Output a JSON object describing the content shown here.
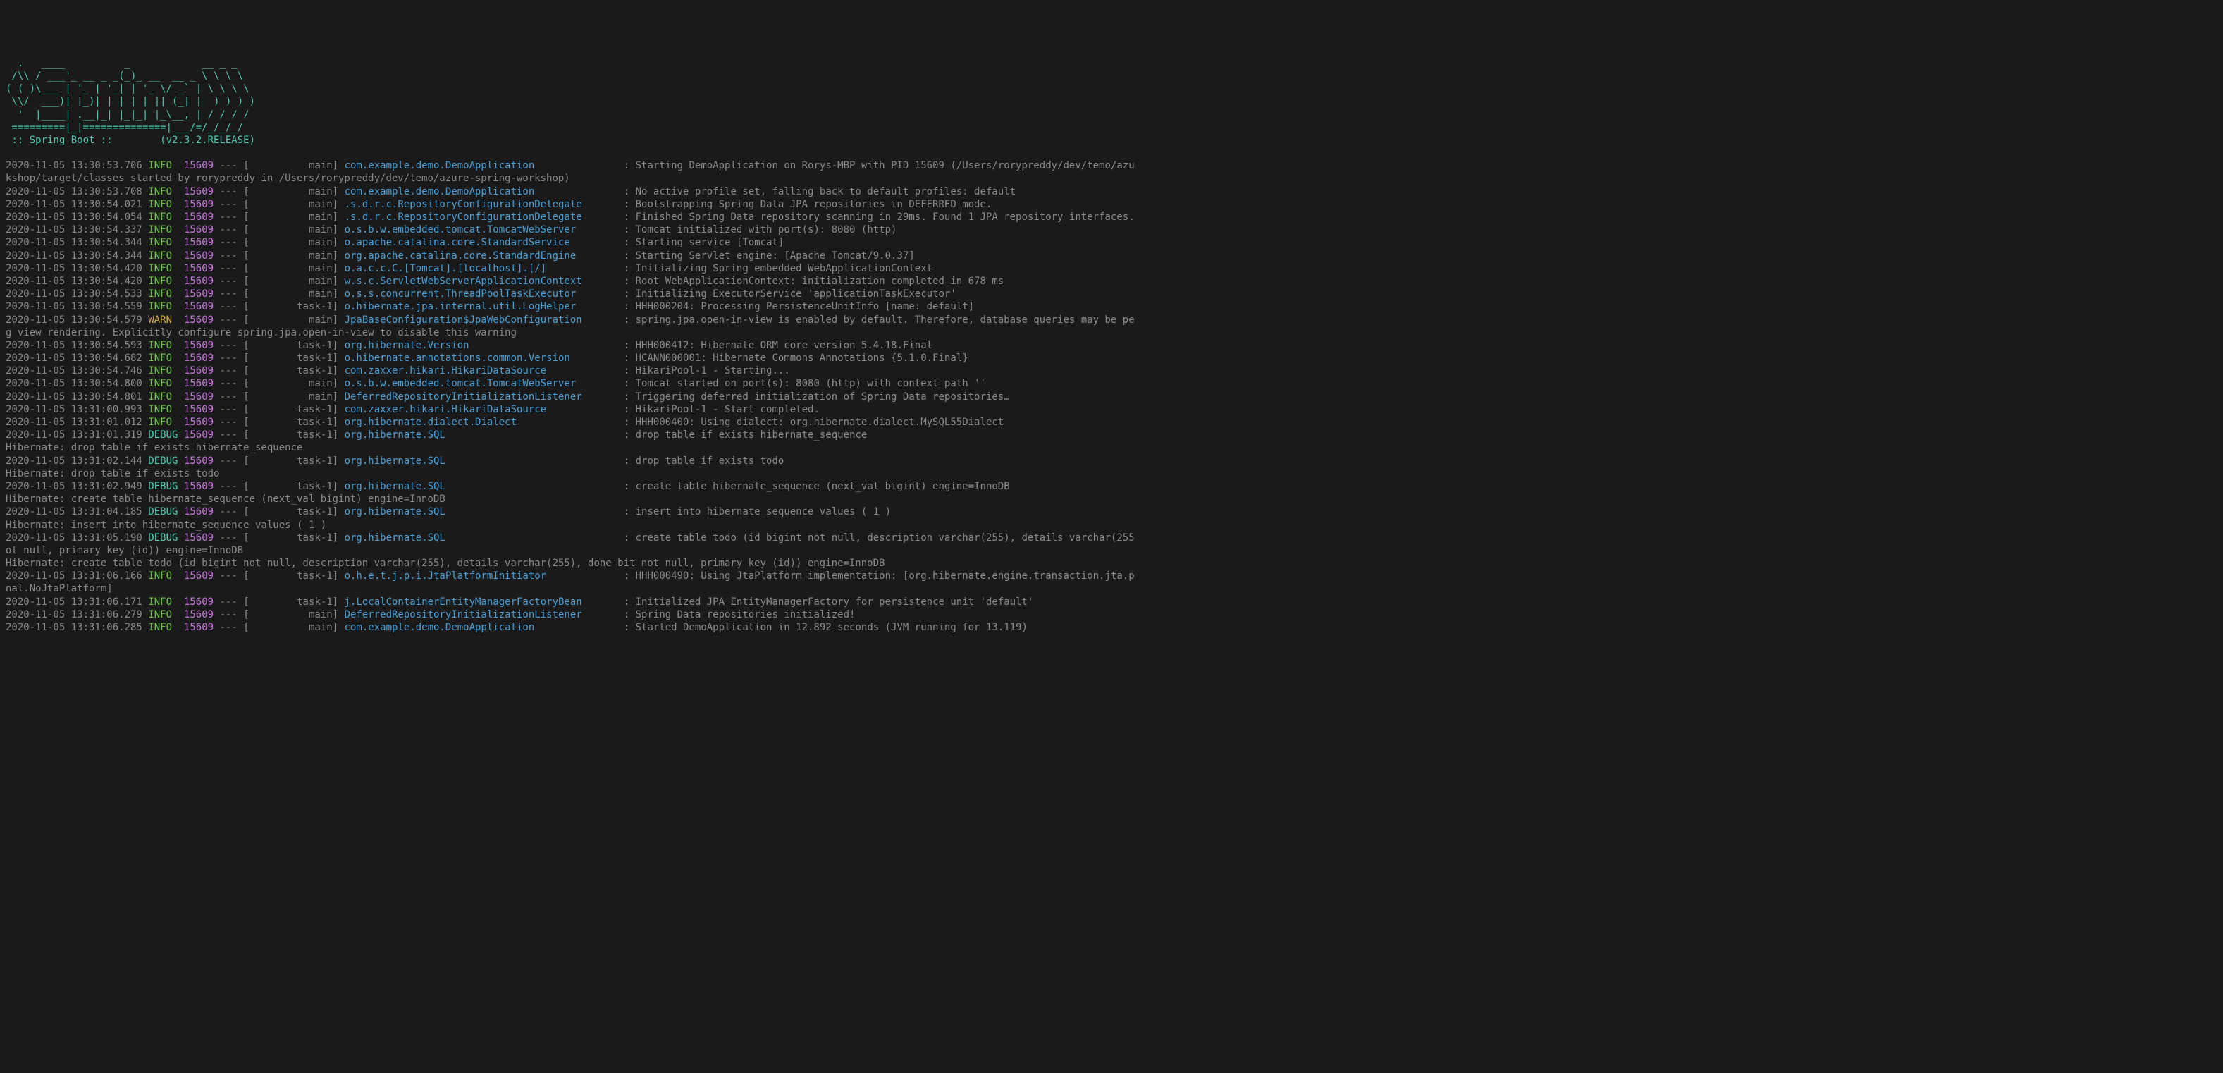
{
  "banner": {
    "ascii_line1": "  .   ____          _            __ _ _",
    "ascii_line2": " /\\\\ / ___'_ __ _ _(_)_ __  __ _ \\ \\ \\ \\",
    "ascii_line3": "( ( )\\___ | '_ | '_| | '_ \\/ _` | \\ \\ \\ \\",
    "ascii_line4": " \\\\/  ___)| |_)| | | | | || (_| |  ) ) ) )",
    "ascii_line5": "  '  |____| .__|_| |_|_| |_\\__, | / / / /",
    "ascii_line6": " =========|_|==============|___/=/_/_/_/",
    "boot_line": " :: Spring Boot ::        (v2.3.2.RELEASE)"
  },
  "logs": [
    {
      "ts": "2020-11-05 13:30:53.706",
      "level": "INFO",
      "pid": "15609",
      "thread": "          main",
      "logger": "com.example.demo.DemoApplication              ",
      "msg": "Starting DemoApplication on Rorys-MBP with PID 15609 (/Users/rorypreddy/dev/temo/azu"
    },
    {
      "continuation": "kshop/target/classes started by rorypreddy in /Users/rorypreddy/dev/temo/azure-spring-workshop)"
    },
    {
      "ts": "2020-11-05 13:30:53.708",
      "level": "INFO",
      "pid": "15609",
      "thread": "          main",
      "logger": "com.example.demo.DemoApplication              ",
      "msg": "No active profile set, falling back to default profiles: default"
    },
    {
      "ts": "2020-11-05 13:30:54.021",
      "level": "INFO",
      "pid": "15609",
      "thread": "          main",
      "logger": ".s.d.r.c.RepositoryConfigurationDelegate      ",
      "msg": "Bootstrapping Spring Data JPA repositories in DEFERRED mode."
    },
    {
      "ts": "2020-11-05 13:30:54.054",
      "level": "INFO",
      "pid": "15609",
      "thread": "          main",
      "logger": ".s.d.r.c.RepositoryConfigurationDelegate      ",
      "msg": "Finished Spring Data repository scanning in 29ms. Found 1 JPA repository interfaces."
    },
    {
      "ts": "2020-11-05 13:30:54.337",
      "level": "INFO",
      "pid": "15609",
      "thread": "          main",
      "logger": "o.s.b.w.embedded.tomcat.TomcatWebServer       ",
      "msg": "Tomcat initialized with port(s): 8080 (http)"
    },
    {
      "ts": "2020-11-05 13:30:54.344",
      "level": "INFO",
      "pid": "15609",
      "thread": "          main",
      "logger": "o.apache.catalina.core.StandardService        ",
      "msg": "Starting service [Tomcat]"
    },
    {
      "ts": "2020-11-05 13:30:54.344",
      "level": "INFO",
      "pid": "15609",
      "thread": "          main",
      "logger": "org.apache.catalina.core.StandardEngine       ",
      "msg": "Starting Servlet engine: [Apache Tomcat/9.0.37]"
    },
    {
      "ts": "2020-11-05 13:30:54.420",
      "level": "INFO",
      "pid": "15609",
      "thread": "          main",
      "logger": "o.a.c.c.C.[Tomcat].[localhost].[/]            ",
      "msg": "Initializing Spring embedded WebApplicationContext"
    },
    {
      "ts": "2020-11-05 13:30:54.420",
      "level": "INFO",
      "pid": "15609",
      "thread": "          main",
      "logger": "w.s.c.ServletWebServerApplicationContext      ",
      "msg": "Root WebApplicationContext: initialization completed in 678 ms"
    },
    {
      "ts": "2020-11-05 13:30:54.533",
      "level": "INFO",
      "pid": "15609",
      "thread": "          main",
      "logger": "o.s.s.concurrent.ThreadPoolTaskExecutor       ",
      "msg": "Initializing ExecutorService 'applicationTaskExecutor'"
    },
    {
      "ts": "2020-11-05 13:30:54.559",
      "level": "INFO",
      "pid": "15609",
      "thread": "        task-1",
      "logger": "o.hibernate.jpa.internal.util.LogHelper       ",
      "msg": "HHH000204: Processing PersistenceUnitInfo [name: default]"
    },
    {
      "ts": "2020-11-05 13:30:54.579",
      "level": "WARN",
      "pid": "15609",
      "thread": "          main",
      "logger": "JpaBaseConfiguration$JpaWebConfiguration      ",
      "msg": "spring.jpa.open-in-view is enabled by default. Therefore, database queries may be pe"
    },
    {
      "continuation": "g view rendering. Explicitly configure spring.jpa.open-in-view to disable this warning"
    },
    {
      "ts": "2020-11-05 13:30:54.593",
      "level": "INFO",
      "pid": "15609",
      "thread": "        task-1",
      "logger": "org.hibernate.Version                         ",
      "msg": "HHH000412: Hibernate ORM core version 5.4.18.Final"
    },
    {
      "ts": "2020-11-05 13:30:54.682",
      "level": "INFO",
      "pid": "15609",
      "thread": "        task-1",
      "logger": "o.hibernate.annotations.common.Version        ",
      "msg": "HCANN000001: Hibernate Commons Annotations {5.1.0.Final}"
    },
    {
      "ts": "2020-11-05 13:30:54.746",
      "level": "INFO",
      "pid": "15609",
      "thread": "        task-1",
      "logger": "com.zaxxer.hikari.HikariDataSource            ",
      "msg": "HikariPool-1 - Starting..."
    },
    {
      "ts": "2020-11-05 13:30:54.800",
      "level": "INFO",
      "pid": "15609",
      "thread": "          main",
      "logger": "o.s.b.w.embedded.tomcat.TomcatWebServer       ",
      "msg": "Tomcat started on port(s): 8080 (http) with context path ''"
    },
    {
      "ts": "2020-11-05 13:30:54.801",
      "level": "INFO",
      "pid": "15609",
      "thread": "          main",
      "logger": "DeferredRepositoryInitializationListener      ",
      "msg": "Triggering deferred initialization of Spring Data repositories…"
    },
    {
      "ts": "2020-11-05 13:31:00.993",
      "level": "INFO",
      "pid": "15609",
      "thread": "        task-1",
      "logger": "com.zaxxer.hikari.HikariDataSource            ",
      "msg": "HikariPool-1 - Start completed."
    },
    {
      "ts": "2020-11-05 13:31:01.012",
      "level": "INFO",
      "pid": "15609",
      "thread": "        task-1",
      "logger": "org.hibernate.dialect.Dialect                 ",
      "msg": "HHH000400: Using dialect: org.hibernate.dialect.MySQL55Dialect"
    },
    {
      "ts": "2020-11-05 13:31:01.319",
      "level": "DEBUG",
      "pid": "15609",
      "thread": "        task-1",
      "logger": "org.hibernate.SQL                             ",
      "msg": "drop table if exists hibernate_sequence"
    },
    {
      "continuation": "Hibernate: drop table if exists hibernate_sequence"
    },
    {
      "ts": "2020-11-05 13:31:02.144",
      "level": "DEBUG",
      "pid": "15609",
      "thread": "        task-1",
      "logger": "org.hibernate.SQL                             ",
      "msg": "drop table if exists todo"
    },
    {
      "continuation": "Hibernate: drop table if exists todo"
    },
    {
      "ts": "2020-11-05 13:31:02.949",
      "level": "DEBUG",
      "pid": "15609",
      "thread": "        task-1",
      "logger": "org.hibernate.SQL                             ",
      "msg": "create table hibernate_sequence (next_val bigint) engine=InnoDB"
    },
    {
      "continuation": "Hibernate: create table hibernate_sequence (next_val bigint) engine=InnoDB"
    },
    {
      "ts": "2020-11-05 13:31:04.185",
      "level": "DEBUG",
      "pid": "15609",
      "thread": "        task-1",
      "logger": "org.hibernate.SQL                             ",
      "msg": "insert into hibernate_sequence values ( 1 )"
    },
    {
      "continuation": "Hibernate: insert into hibernate_sequence values ( 1 )"
    },
    {
      "ts": "2020-11-05 13:31:05.190",
      "level": "DEBUG",
      "pid": "15609",
      "thread": "        task-1",
      "logger": "org.hibernate.SQL                             ",
      "msg": "create table todo (id bigint not null, description varchar(255), details varchar(255"
    },
    {
      "continuation": "ot null, primary key (id)) engine=InnoDB"
    },
    {
      "continuation": "Hibernate: create table todo (id bigint not null, description varchar(255), details varchar(255), done bit not null, primary key (id)) engine=InnoDB"
    },
    {
      "ts": "2020-11-05 13:31:06.166",
      "level": "INFO",
      "pid": "15609",
      "thread": "        task-1",
      "logger": "o.h.e.t.j.p.i.JtaPlatformInitiator            ",
      "msg": "HHH000490: Using JtaPlatform implementation: [org.hibernate.engine.transaction.jta.p"
    },
    {
      "continuation": "nal.NoJtaPlatform]"
    },
    {
      "ts": "2020-11-05 13:31:06.171",
      "level": "INFO",
      "pid": "15609",
      "thread": "        task-1",
      "logger": "j.LocalContainerEntityManagerFactoryBean      ",
      "msg": "Initialized JPA EntityManagerFactory for persistence unit 'default'"
    },
    {
      "ts": "2020-11-05 13:31:06.279",
      "level": "INFO",
      "pid": "15609",
      "thread": "          main",
      "logger": "DeferredRepositoryInitializationListener      ",
      "msg": "Spring Data repositories initialized!"
    },
    {
      "ts": "2020-11-05 13:31:06.285",
      "level": "INFO",
      "pid": "15609",
      "thread": "          main",
      "logger": "com.example.demo.DemoApplication              ",
      "msg": "Started DemoApplication in 12.892 seconds (JVM running for 13.119)"
    }
  ]
}
